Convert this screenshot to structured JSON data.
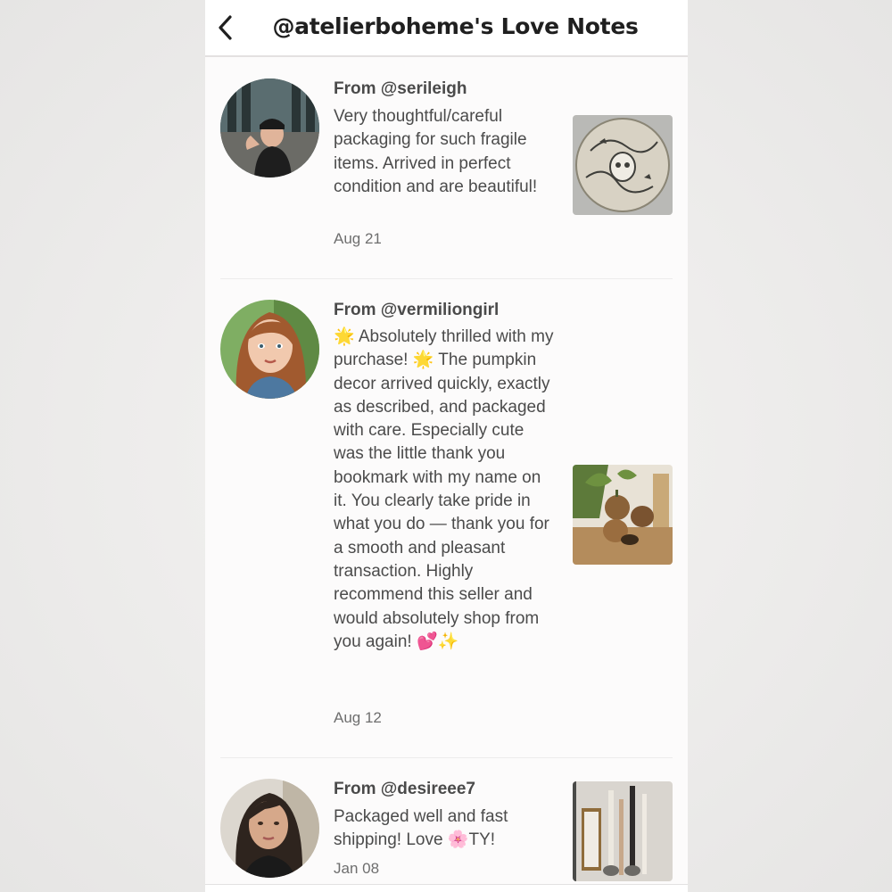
{
  "header": {
    "title": "@atelierboheme's Love Notes",
    "back_icon": "chevron-left-icon"
  },
  "notes": [
    {
      "from": "From @serileigh",
      "message": "Very thoughtful/careful packaging for such fragile items. Arrived in perfect condition and are beautiful!",
      "date": "Aug 21"
    },
    {
      "from": "From @vermiliongirl",
      "message": "🌟 Absolutely thrilled with my purchase! 🌟 The pumpkin decor arrived quickly, exactly as described, and packaged with care. Especially cute was the little thank you bookmark with my name on it. You clearly take pride in what you do — thank you for a smooth and pleasant transaction. Highly recommend this seller and would absolutely shop from you again! 💕✨",
      "date": "Aug 12"
    },
    {
      "from": "From @desireee7",
      "message": "Packaged well and fast shipping! Love 🌸TY!",
      "date": "Jan 08"
    }
  ],
  "colors": {
    "background": "#fcfbfb",
    "text": "#4b4b4b",
    "title": "#1f1f1f",
    "date": "#6e6e6e"
  }
}
